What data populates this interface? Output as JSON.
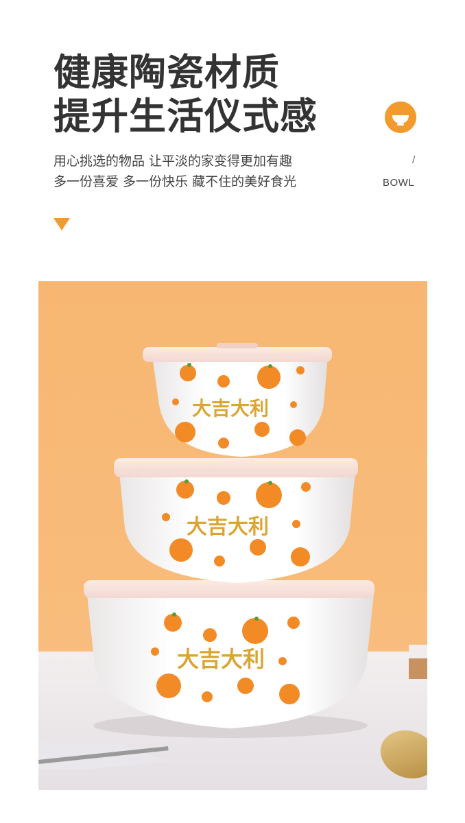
{
  "headline": {
    "line1": "健康陶瓷材质",
    "line2": "提升生活仪式感"
  },
  "subtitle": {
    "line1": "用心挑选的物品 让平淡的家变得更加有趣",
    "line2": "多一份喜爱 多一份快乐 藏不住的美好食光"
  },
  "badge": {
    "icon": "bowl-icon",
    "slash": "/",
    "label": "BOWL"
  },
  "photo": {
    "bowl_text": "大吉大利"
  },
  "colors": {
    "accent": "#f39a2c",
    "background_orange": "#f6b36f",
    "heading": "#333333"
  }
}
